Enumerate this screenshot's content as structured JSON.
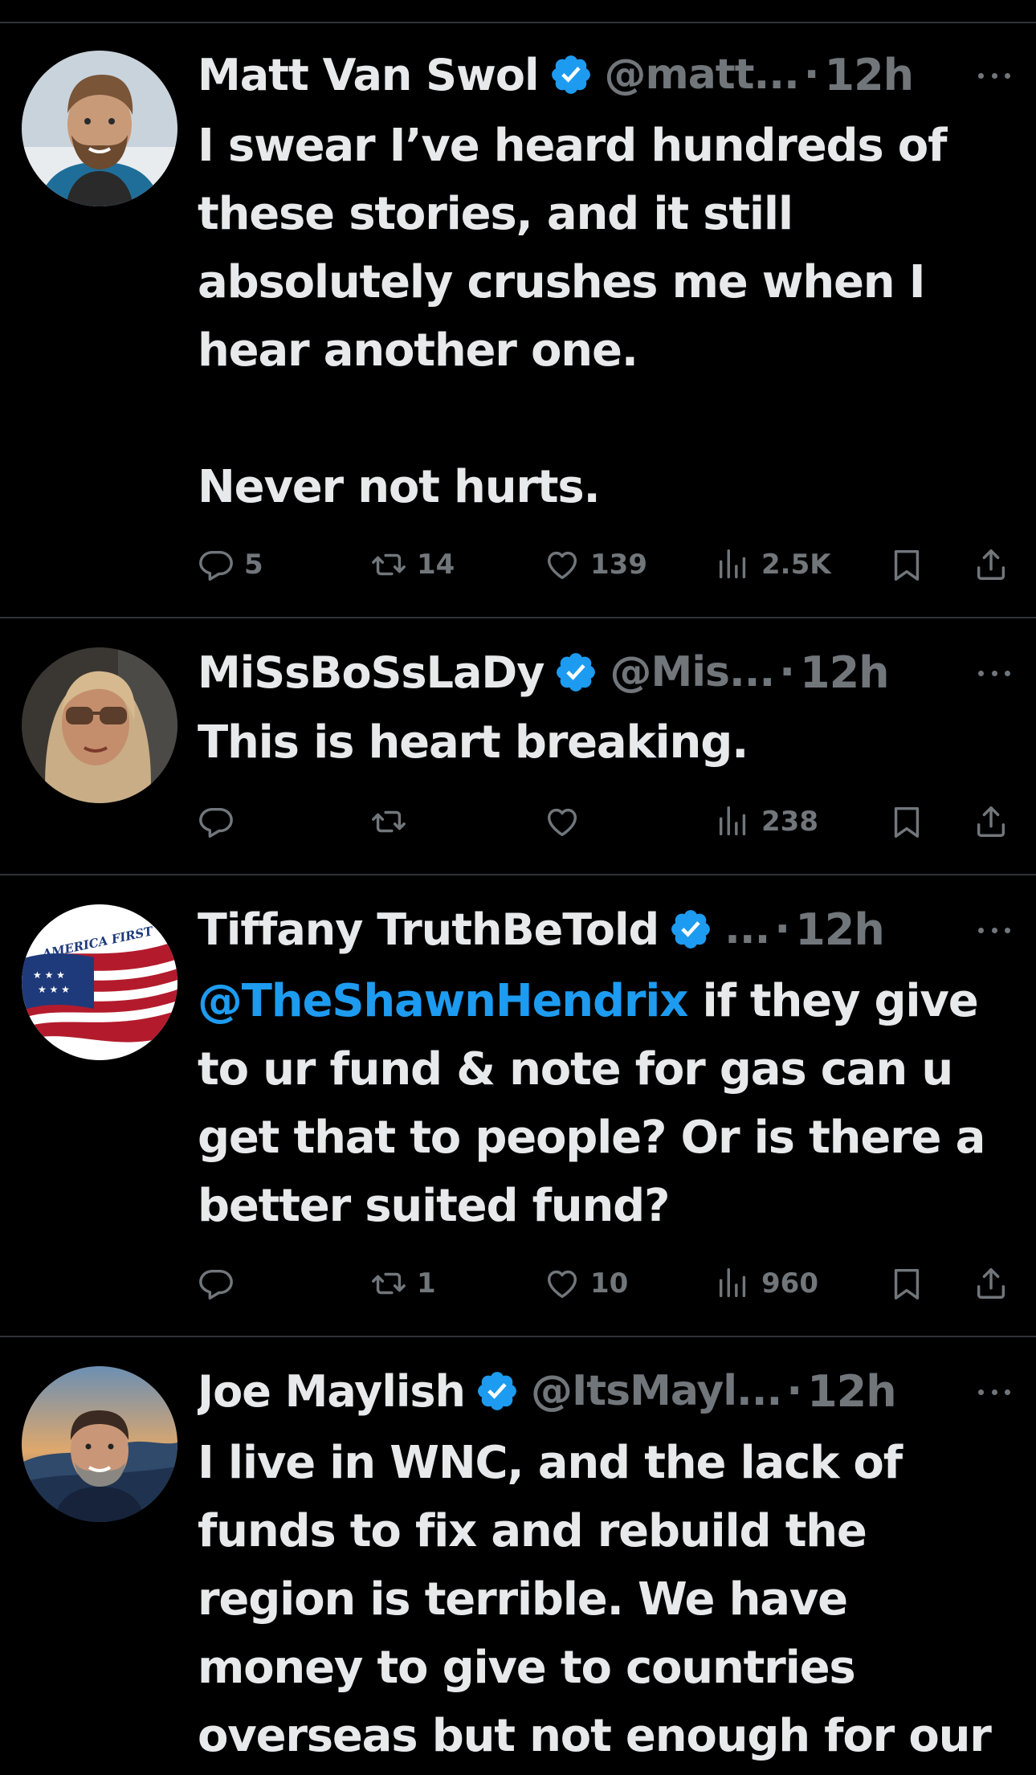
{
  "tweets": [
    {
      "name": "Matt Van Swol",
      "handle": "@matt...",
      "dot": "·",
      "time": "12h",
      "text": "I swear I’ve heard hundreds of\nthese stories, and it still\nabsolutely crushes me when I\nhear another one.\n\nNever not hurts.",
      "replies": "5",
      "reposts": "14",
      "likes": "139",
      "views": "2.5K"
    },
    {
      "name": "MiSsBoSsLaDy",
      "handle": "@Mis...",
      "dot": "·",
      "time": "12h",
      "text": "This is heart breaking.",
      "replies": "",
      "reposts": "",
      "likes": "",
      "views": "238"
    },
    {
      "name": "Tiffany TruthBeTold",
      "handle": "...",
      "dot": "·",
      "time": "12h",
      "mention": "@TheShawnHendrix",
      "text": " if they give\nto ur fund & note for gas can u\nget that to people? Or is there a\nbetter suited fund?",
      "avatar_text": "AMERICA FIRST",
      "replies": "",
      "reposts": "1",
      "likes": "10",
      "views": "960"
    },
    {
      "name": "Joe Maylish",
      "handle": "@ItsMayl...",
      "dot": "·",
      "time": "12h",
      "text": "I live in WNC, and the lack of\nfunds to fix and rebuild the\nregion is terrible. We have\nmoney to give to countries\noverseas but not enough for our"
    }
  ],
  "icons": {
    "verified": "verified-badge-icon",
    "reply": "reply-icon",
    "repost": "repost-icon",
    "like": "like-icon",
    "views": "views-icon",
    "bookmark": "bookmark-icon",
    "share": "share-icon",
    "more": "more-icon"
  },
  "colors": {
    "background": "#000000",
    "text": "#e7e9ea",
    "muted": "#71767b",
    "link": "#1d9bf0",
    "verified": "#1d9bf0",
    "divider": "#2f3336"
  }
}
